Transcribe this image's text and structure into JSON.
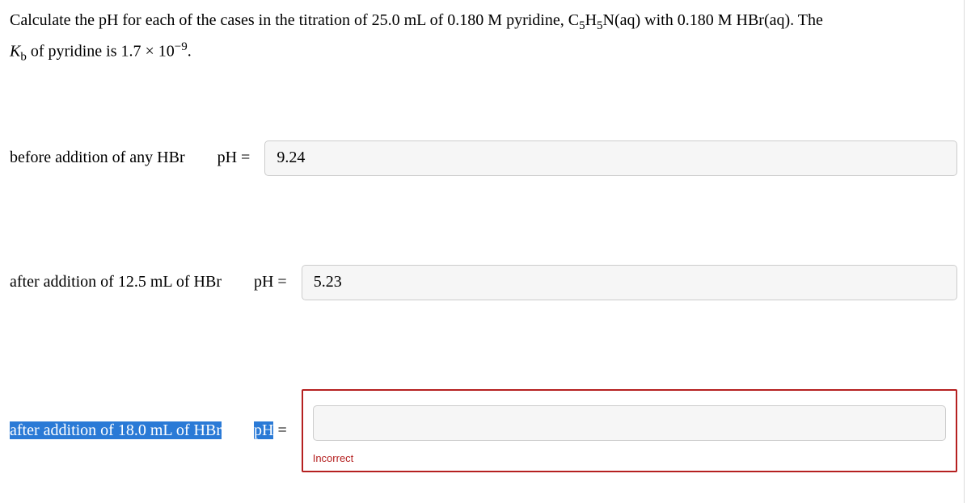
{
  "question": {
    "pre": "Calculate the pH for each of the cases in the titration of 25.0 mL of 0.180 M pyridine, C",
    "sub1": "5",
    "mid1": "H",
    "sub2": "5",
    "mid2": "N(aq) with 0.180 M HBr(aq). The ",
    "kb_pre": "K",
    "kb_sub": "b",
    "kb_mid": " of pyridine is 1.7 × 10",
    "kb_sup": "−9",
    "kb_end": "."
  },
  "rows": {
    "r1": {
      "label": "before addition of any HBr",
      "eq": "pH =",
      "value": "9.24"
    },
    "r2": {
      "label": "after addition of 12.5 mL of HBr",
      "eq": "pH =",
      "value": "5.23"
    },
    "r3": {
      "label_a": "after addition of 18.0 mL",
      "label_b": " of HBr",
      "eq_a": "pH",
      "eq_b": " =",
      "value": "",
      "feedback": "Incorrect"
    }
  }
}
